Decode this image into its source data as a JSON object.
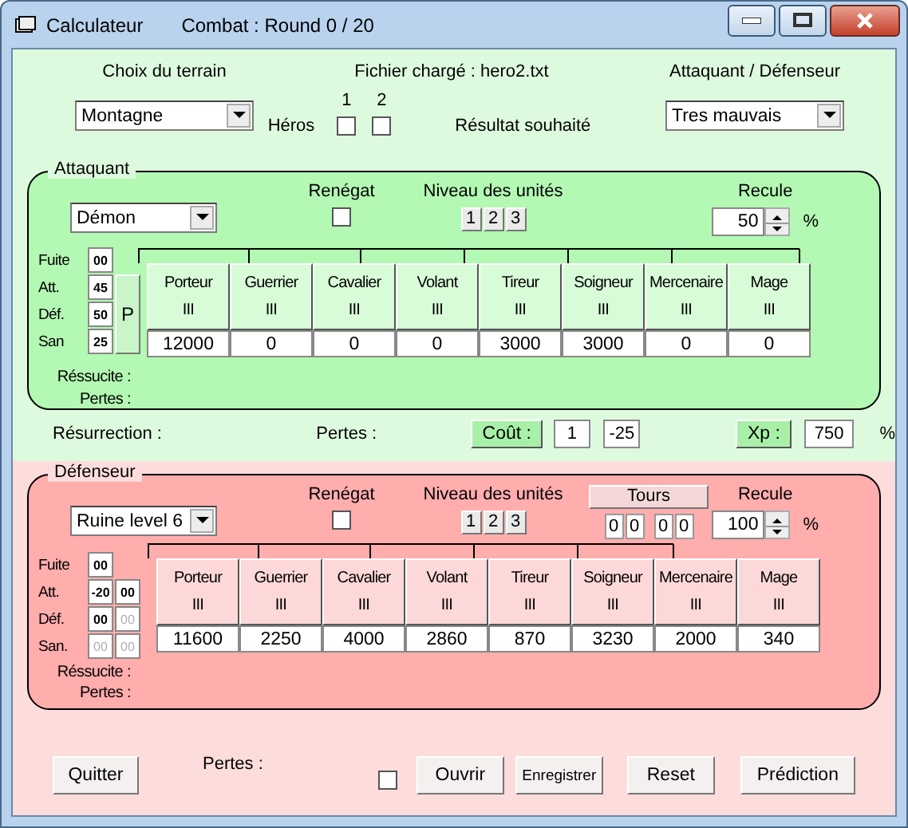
{
  "window": {
    "title": "Calculateur",
    "subtitle": "Combat :  Round  0 / 20"
  },
  "header": {
    "terrain_label": "Choix du terrain",
    "terrain": "Montagne",
    "file_label": "Fichier chargé : hero2.txt",
    "role_label": "Attaquant / Défenseur",
    "heroes_label": "Héros",
    "heroes": [
      {
        "label": "1",
        "checked": false
      },
      {
        "label": "2",
        "checked": false
      }
    ],
    "result_label": "Résultat souhaité",
    "result": "Tres mauvais"
  },
  "attacker": {
    "title": "Attaquant",
    "race": "Démon",
    "renegade_label": "Renégat",
    "renegade_checked": false,
    "levels_label": "Niveau des unités",
    "levels": [
      "1",
      "2",
      "3"
    ],
    "retreat_label": "Recule",
    "retreat": "50",
    "percent": "%",
    "stats": [
      {
        "label": "Fuite",
        "values": [
          {
            "text": "00",
            "disabled": false
          }
        ]
      },
      {
        "label": "Att.",
        "values": [
          {
            "text": "45",
            "disabled": false
          }
        ]
      },
      {
        "label": "Déf.",
        "values": [
          {
            "text": "50",
            "disabled": false
          }
        ]
      },
      {
        "label": "San",
        "values": [
          {
            "text": "25",
            "disabled": false
          }
        ]
      }
    ],
    "p_button": "P",
    "units": [
      {
        "name": "Porteur",
        "level": "III",
        "count": "12000"
      },
      {
        "name": "Guerrier",
        "level": "III",
        "count": "0"
      },
      {
        "name": "Cavalier",
        "level": "III",
        "count": "0"
      },
      {
        "name": "Volant",
        "level": "III",
        "count": "0"
      },
      {
        "name": "Tireur",
        "level": "III",
        "count": "3000"
      },
      {
        "name": "Soigneur",
        "level": "III",
        "count": "3000"
      },
      {
        "name": "Mercenaire",
        "level": "III",
        "count": "0"
      },
      {
        "name": "Mage",
        "level": "III",
        "count": "0"
      }
    ],
    "revive_label": "Réssucite :",
    "losses_label": "Pertes :"
  },
  "middle": {
    "resurrection_label": "Résurrection :",
    "losses_label": "Pertes :",
    "cost_button": "Coût :",
    "cost_values": [
      "1",
      "-25"
    ],
    "xp_button": "Xp :",
    "xp_value": "750",
    "percent": "%"
  },
  "defender": {
    "title": "Défenseur",
    "race": "Ruine level 6",
    "renegade_label": "Renégat",
    "renegade_checked": false,
    "levels_label": "Niveau des unités",
    "levels": [
      "1",
      "2",
      "3"
    ],
    "towers_button": "Tours",
    "towers": [
      [
        "0",
        "0"
      ],
      [
        "0",
        "0"
      ]
    ],
    "retreat_label": "Recule",
    "retreat": "100",
    "percent": "%",
    "stats": [
      {
        "label": "Fuite",
        "values": [
          {
            "text": "00",
            "disabled": false
          }
        ]
      },
      {
        "label": "Att.",
        "values": [
          {
            "text": "-20",
            "disabled": false
          },
          {
            "text": "00",
            "disabled": false
          }
        ]
      },
      {
        "label": "Déf.",
        "values": [
          {
            "text": "00",
            "disabled": false
          },
          {
            "text": "00",
            "disabled": true
          }
        ]
      },
      {
        "label": "San.",
        "values": [
          {
            "text": "00",
            "disabled": true
          },
          {
            "text": "00",
            "disabled": true
          }
        ]
      }
    ],
    "units": [
      {
        "name": "Porteur",
        "level": "III",
        "count": "11600"
      },
      {
        "name": "Guerrier",
        "level": "III",
        "count": "2250"
      },
      {
        "name": "Cavalier",
        "level": "III",
        "count": "4000"
      },
      {
        "name": "Volant",
        "level": "III",
        "count": "2860"
      },
      {
        "name": "Tireur",
        "level": "III",
        "count": "870"
      },
      {
        "name": "Soigneur",
        "level": "III",
        "count": "3230"
      },
      {
        "name": "Mercenaire",
        "level": "III",
        "count": "2000"
      },
      {
        "name": "Mage",
        "level": "III",
        "count": "340"
      }
    ],
    "revive_label": "Réssucite :",
    "losses_label": "Pertes :"
  },
  "footer": {
    "quit_button": "Quitter",
    "losses_label": "Pertes :",
    "losses_checked": false,
    "open_button": "Ouvrir",
    "save_button": "Enregistrer",
    "reset_button": "Reset",
    "predict_button": "Prédiction"
  }
}
